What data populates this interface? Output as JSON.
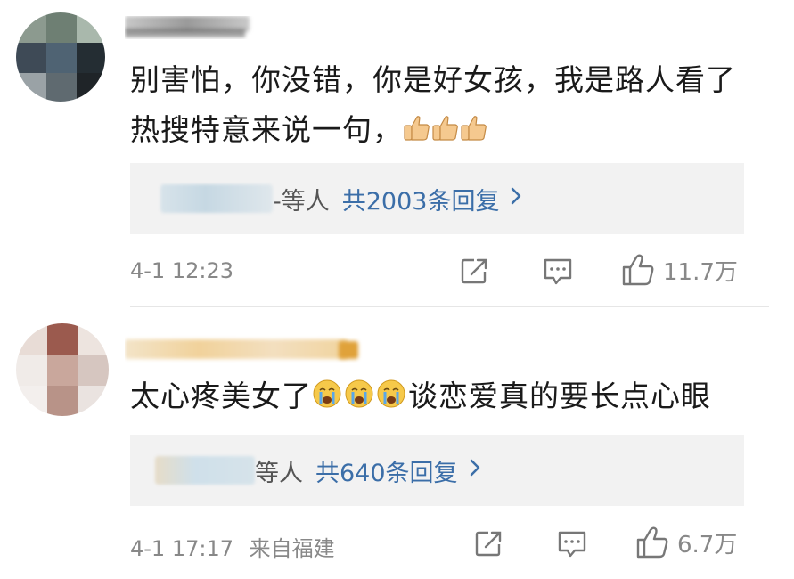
{
  "comments": [
    {
      "text": "别害怕，你没错，你是好女孩，我是路人看了热搜特意来说一句，",
      "emoji": [
        "thumbs-up",
        "thumbs-up",
        "thumbs-up"
      ],
      "reply_suffix": "-等人",
      "reply_link": "共2003条回复",
      "time": "4-1 12:23",
      "location": "",
      "likes": "11.7万"
    },
    {
      "text_before": "太心疼美女了",
      "emoji": [
        "crying-face",
        "crying-face",
        "crying-face"
      ],
      "text_after": "谈恋爱真的要长点心眼",
      "reply_suffix": "等人",
      "reply_link": "共640条回复",
      "time": "4-1 17:17",
      "location": "来自福建",
      "likes": "6.7万"
    }
  ],
  "icons": {
    "share": "share-icon",
    "comment": "comment-icon",
    "like": "thumbs-up-icon",
    "reply_arrow": "chevron-right-icon"
  },
  "colors": {
    "link": "#3b6ea8",
    "meta": "#888888",
    "reply_bg": "#f2f2f2"
  }
}
